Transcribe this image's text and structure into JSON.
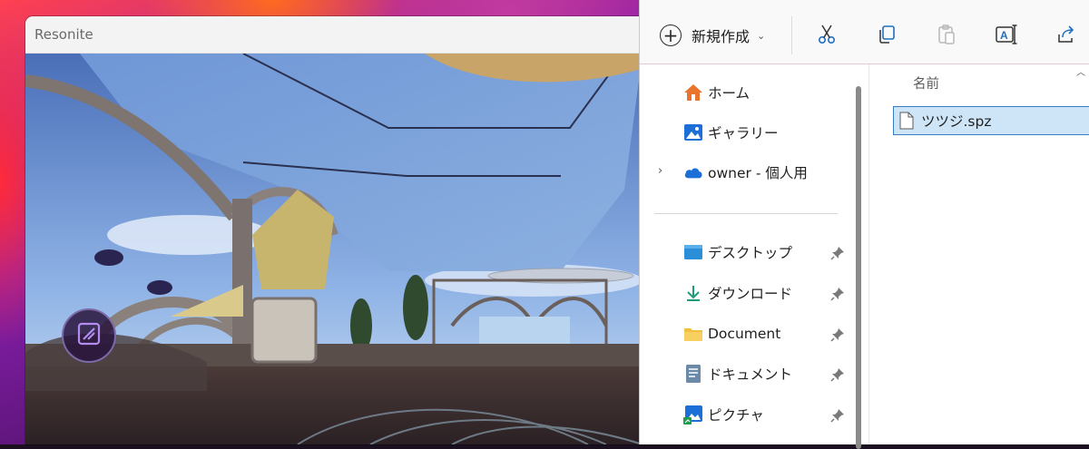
{
  "resonite": {
    "title": "Resonite",
    "menu_button_icon": "dash-menu-icon"
  },
  "explorer": {
    "toolbar": {
      "new_label": "新規作成",
      "icons": [
        "cut-icon",
        "copy-icon",
        "paste-icon",
        "rename-icon",
        "share-icon"
      ]
    },
    "nav": {
      "home": "ホーム",
      "gallery": "ギャラリー",
      "onedrive": "owner - 個人用",
      "quick_access": [
        {
          "label": "デスクトップ",
          "icon": "desktop-folder-icon"
        },
        {
          "label": "ダウンロード",
          "icon": "download-icon"
        },
        {
          "label": "Document",
          "icon": "folder-icon"
        },
        {
          "label": "ドキュメント",
          "icon": "documents-icon"
        },
        {
          "label": "ピクチャ",
          "icon": "pictures-icon"
        }
      ]
    },
    "content": {
      "column_name": "名前",
      "files": [
        {
          "name": "ツツジ.spz",
          "selected": true
        }
      ]
    }
  },
  "colors": {
    "selection_bg": "#cde5f7",
    "selection_border": "#3a7cc4",
    "onedrive_blue": "#1b6fd6",
    "home_orange": "#e8742e",
    "folder_yellow": "#f2c040"
  }
}
